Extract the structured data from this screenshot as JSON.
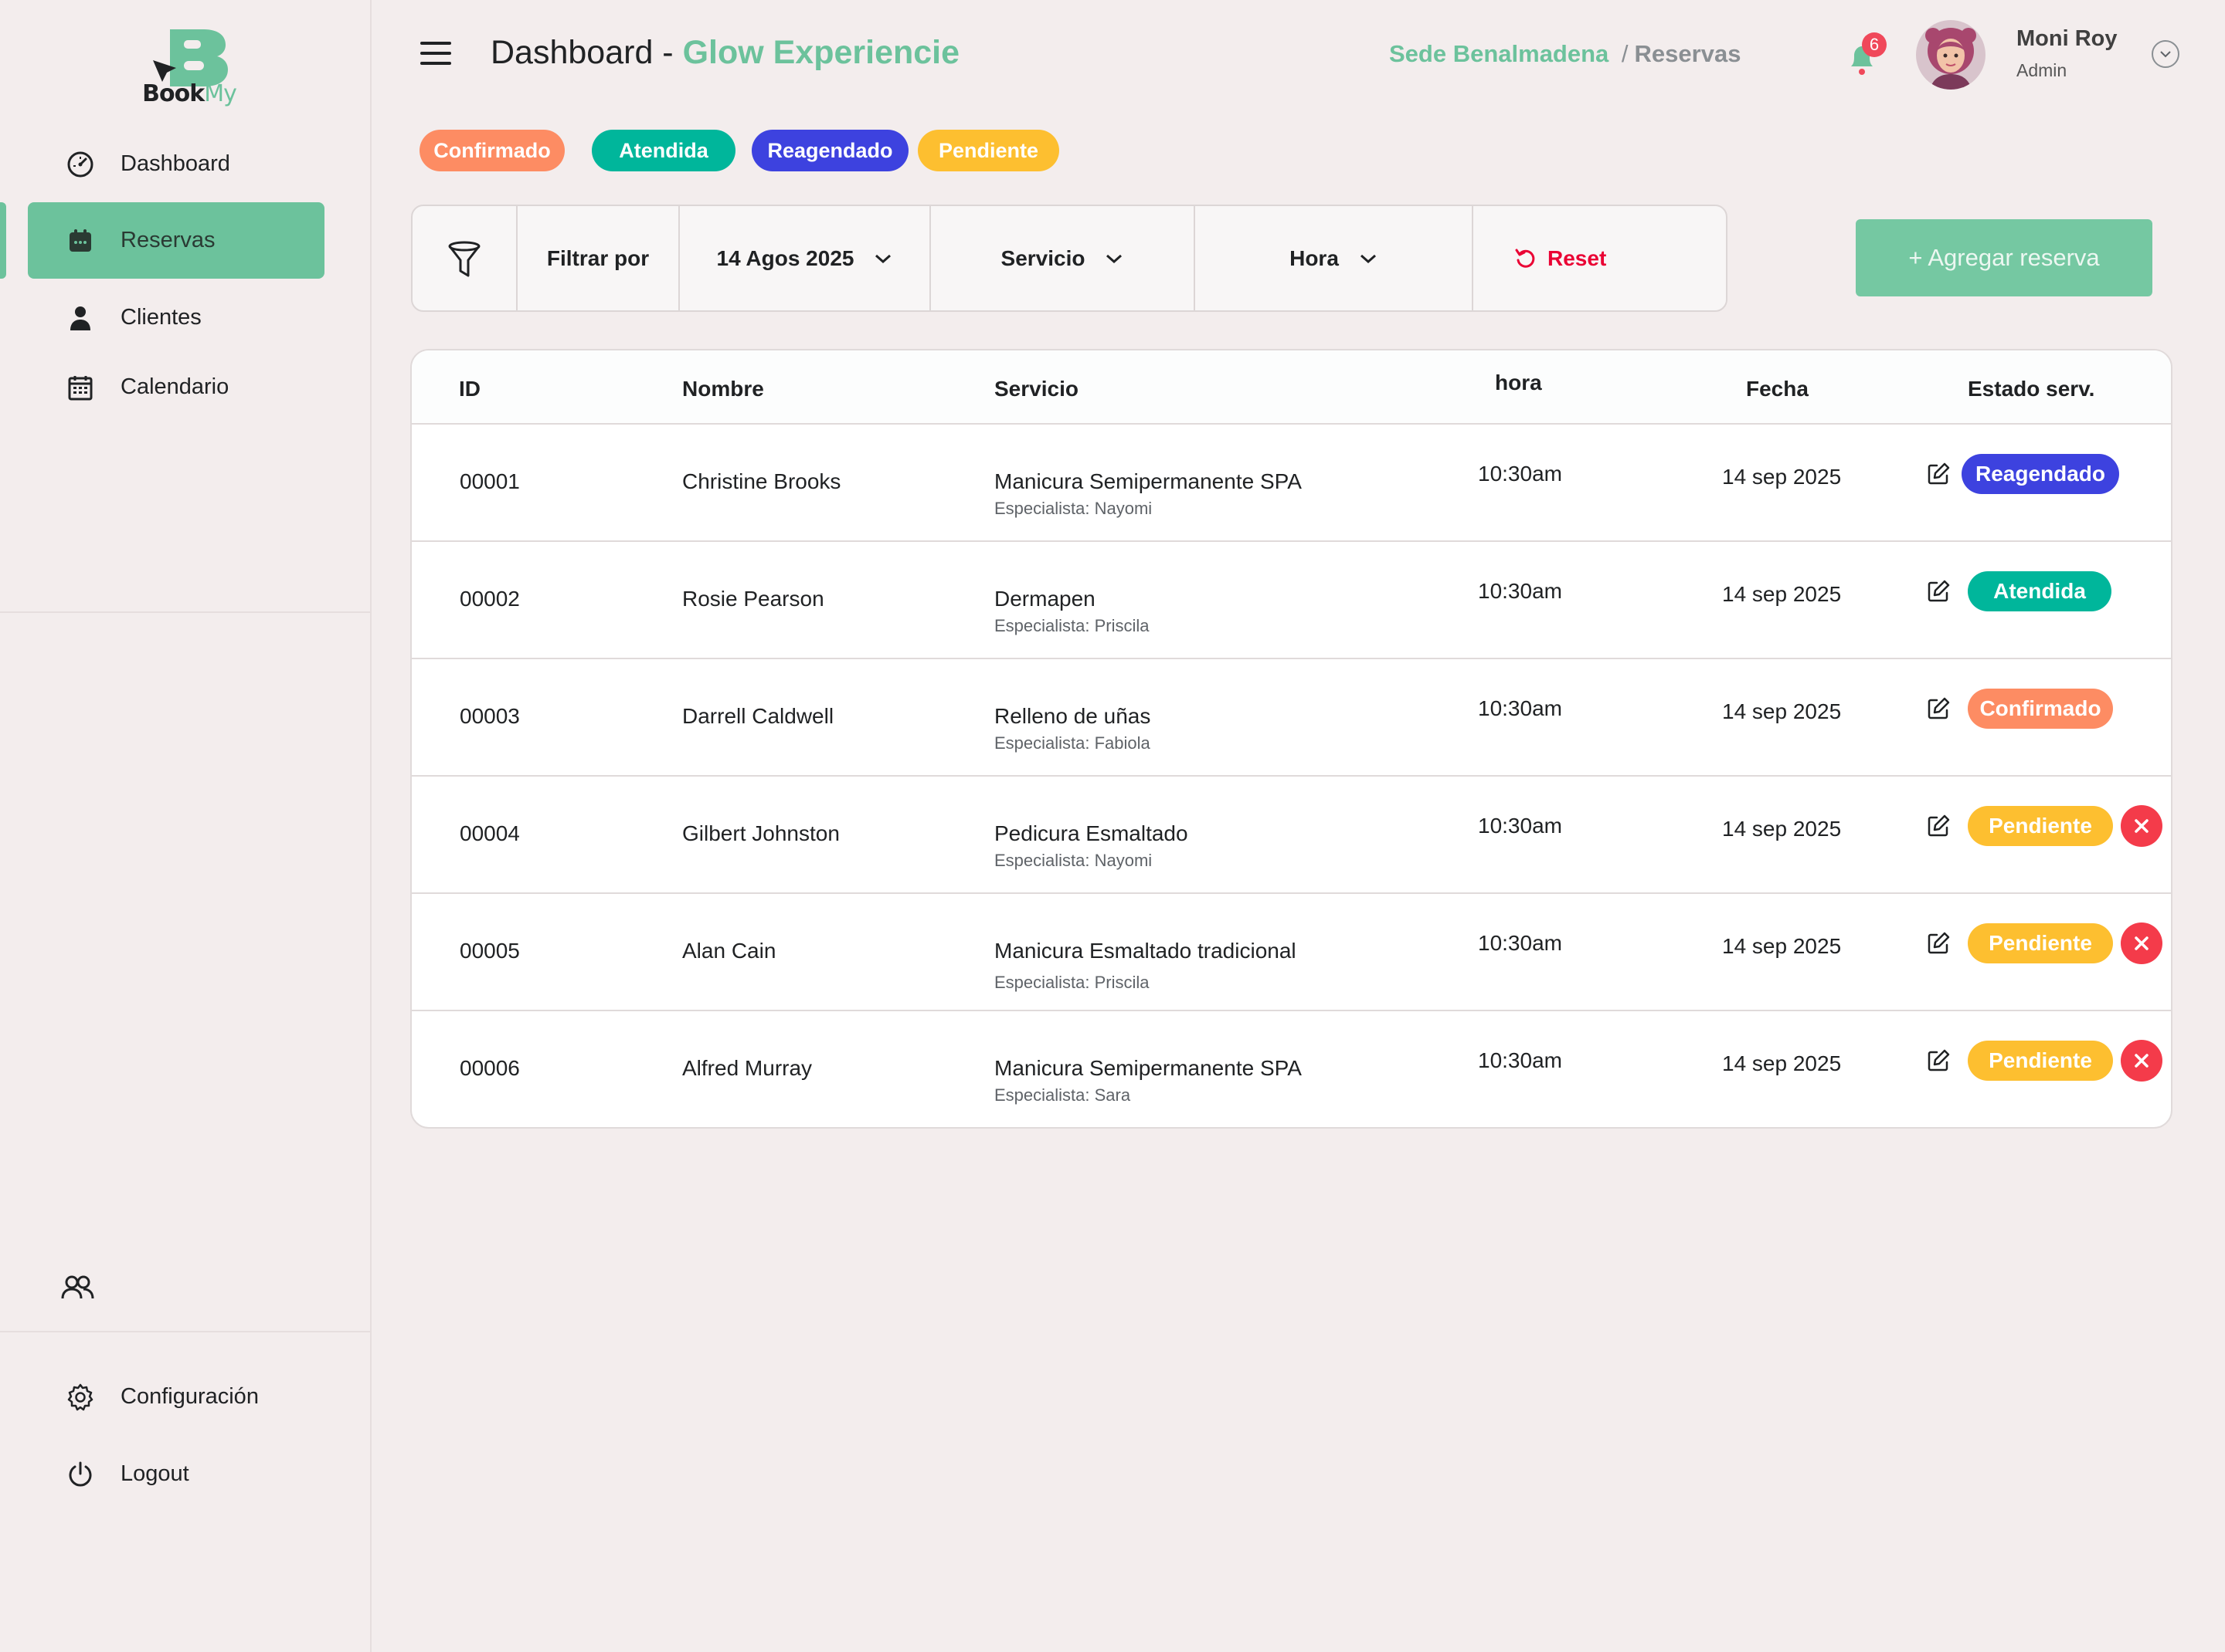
{
  "brand": {
    "word1": "Book",
    "word2": "My"
  },
  "colors": {
    "accent": "#6cc29c",
    "confirmado": "#fd8c63",
    "atendida": "#00b69b",
    "reagendado": "#3d42df",
    "pendiente": "#fdbf30",
    "danger": "#f43b4a"
  },
  "sidebar": {
    "items": [
      {
        "label": "Dashboard",
        "icon": "gauge-icon"
      },
      {
        "label": "Reservas",
        "icon": "calendar-filled-icon",
        "active": true
      },
      {
        "label": "Clientes",
        "icon": "user-icon"
      },
      {
        "label": "Calendario",
        "icon": "calendar-grid-icon"
      }
    ],
    "bottom": [
      {
        "label": "Configuración",
        "icon": "gear-icon"
      },
      {
        "label": "Logout",
        "icon": "power-icon"
      }
    ]
  },
  "header": {
    "title_prefix": "Dashboard - ",
    "title_highlight": "Glow Experiencie",
    "breadcrumb_site": "Sede Benalmadena",
    "breadcrumb_sep": "/",
    "breadcrumb_page": "Reservas",
    "notification_count": "6",
    "user_name": "Moni Roy",
    "user_role": "Admin"
  },
  "legend": [
    "Confirmado",
    "Atendida",
    "Reagendado",
    "Pendiente"
  ],
  "filters": {
    "label": "Filtrar por",
    "date": "14 Agos 2025",
    "service": "Servicio",
    "time": "Hora",
    "reset": "Reset"
  },
  "add_button": "+ Agregar reserva",
  "table": {
    "columns": [
      "ID",
      "Nombre",
      "Servicio",
      "hora",
      "Fecha",
      "Estado serv."
    ],
    "rows": [
      {
        "id": "00001",
        "name": "Christine Brooks",
        "service": "Manicura Semipermanente SPA",
        "specialist": "Especialista: Nayomi",
        "time": "10:30am",
        "date": "14 sep 2025",
        "status": "Reagendado",
        "cancel": false
      },
      {
        "id": "00002",
        "name": "Rosie Pearson",
        "service": "Dermapen",
        "specialist": "Especialista:  Priscila",
        "time": "10:30am",
        "date": "14 sep 2025",
        "status": "Atendida",
        "cancel": false
      },
      {
        "id": "00003",
        "name": "Darrell Caldwell",
        "service": "Relleno de uñas",
        "specialist": "Especialista:  Fabiola",
        "time": "10:30am",
        "date": "14 sep 2025",
        "status": "Confirmado",
        "cancel": false
      },
      {
        "id": "00004",
        "name": "Gilbert Johnston",
        "service": "Pedicura Esmaltado",
        "specialist": "Especialista:  Nayomi",
        "time": "10:30am",
        "date": "14 sep 2025",
        "status": "Pendiente",
        "cancel": true
      },
      {
        "id": "00005",
        "name": "Alan Cain",
        "service": "Manicura  Esmaltado tradicional",
        "specialist": "Especialista:  Priscila",
        "time": "10:30am",
        "date": "14 sep 2025",
        "status": "Pendiente",
        "cancel": true
      },
      {
        "id": "00006",
        "name": "Alfred Murray",
        "service": "Manicura Semipermanente SPA",
        "specialist": "Especialista: Sara",
        "time": "10:30am",
        "date": "14 sep 2025",
        "status": "Pendiente",
        "cancel": true
      }
    ]
  }
}
